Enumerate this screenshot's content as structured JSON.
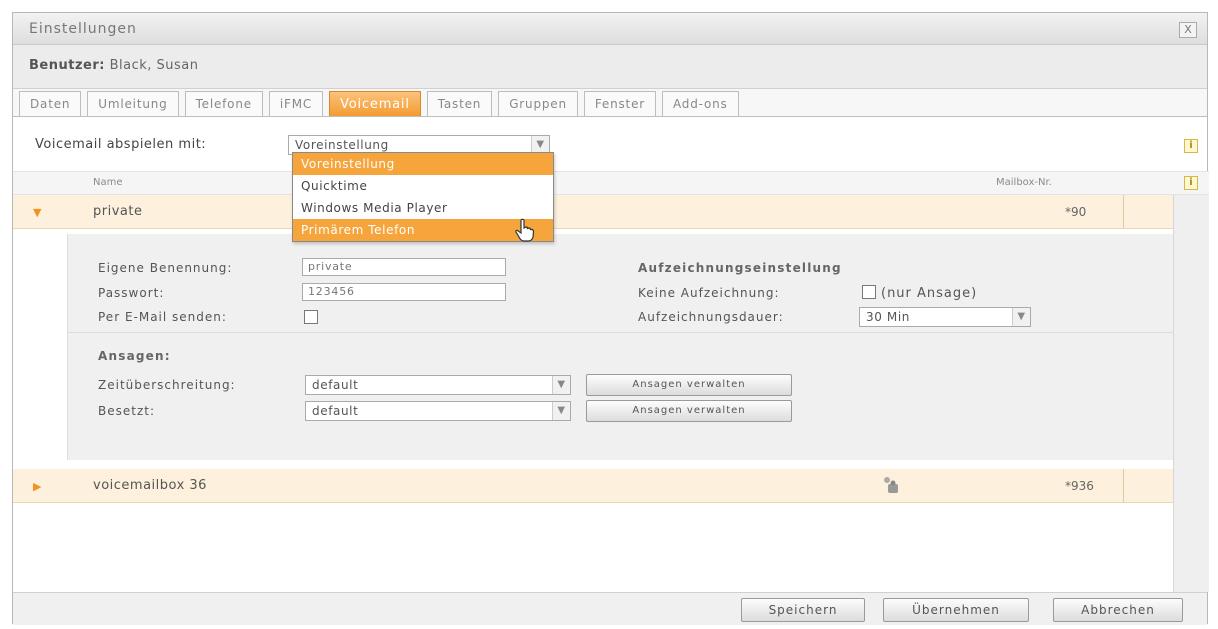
{
  "window": {
    "title": "Einstellungen",
    "close_label": "X"
  },
  "user": {
    "label": "Benutzer:",
    "name": "Black, Susan"
  },
  "tabs": [
    {
      "label": "Daten",
      "active": false
    },
    {
      "label": "Umleitung",
      "active": false
    },
    {
      "label": "Telefone",
      "active": false
    },
    {
      "label": "iFMC",
      "active": false
    },
    {
      "label": "Voicemail",
      "active": true
    },
    {
      "label": "Tasten",
      "active": false
    },
    {
      "label": "Gruppen",
      "active": false
    },
    {
      "label": "Fenster",
      "active": false
    },
    {
      "label": "Add-ons",
      "active": false
    }
  ],
  "playback": {
    "label": "Voicemail abspielen mit:",
    "selected": "Voreinstellung",
    "options": [
      "Voreinstellung",
      "Quicktime",
      "Windows Media Player",
      "Primärem Telefon"
    ],
    "hovered": "Primärem Telefon"
  },
  "columns": {
    "name": "Name",
    "mailbox": "Mailbox-Nr."
  },
  "mailboxes": [
    {
      "name": "private",
      "number": "*90",
      "expanded": true
    },
    {
      "name": "voicemailbox 36",
      "number": "*936",
      "expanded": false
    }
  ],
  "detail": {
    "own_name_label": "Eigene Benennung:",
    "own_name_value": "private",
    "password_label": "Passwort:",
    "password_value": "123456",
    "email_label": "Per E-Mail senden:",
    "email_checked": false,
    "recording_title": "Aufzeichnungseinstellung",
    "no_recording_label": "Keine Aufzeichnung:",
    "no_recording_note": "(nur Ansage)",
    "duration_label": "Aufzeichnungsdauer:",
    "duration_value": "30 Min",
    "announcements_title": "Ansagen:",
    "timeout_label": "Zeitüberschreitung:",
    "timeout_value": "default",
    "busy_label": "Besetzt:",
    "busy_value": "default",
    "manage_label": "Ansagen verwalten"
  },
  "footer": {
    "save": "Speichern",
    "apply": "Übernehmen",
    "cancel": "Abbrechen"
  },
  "colors": {
    "accent": "#f39a2e",
    "row_bg": "#fdf0dc",
    "panel_bg": "#f0f0f0"
  }
}
